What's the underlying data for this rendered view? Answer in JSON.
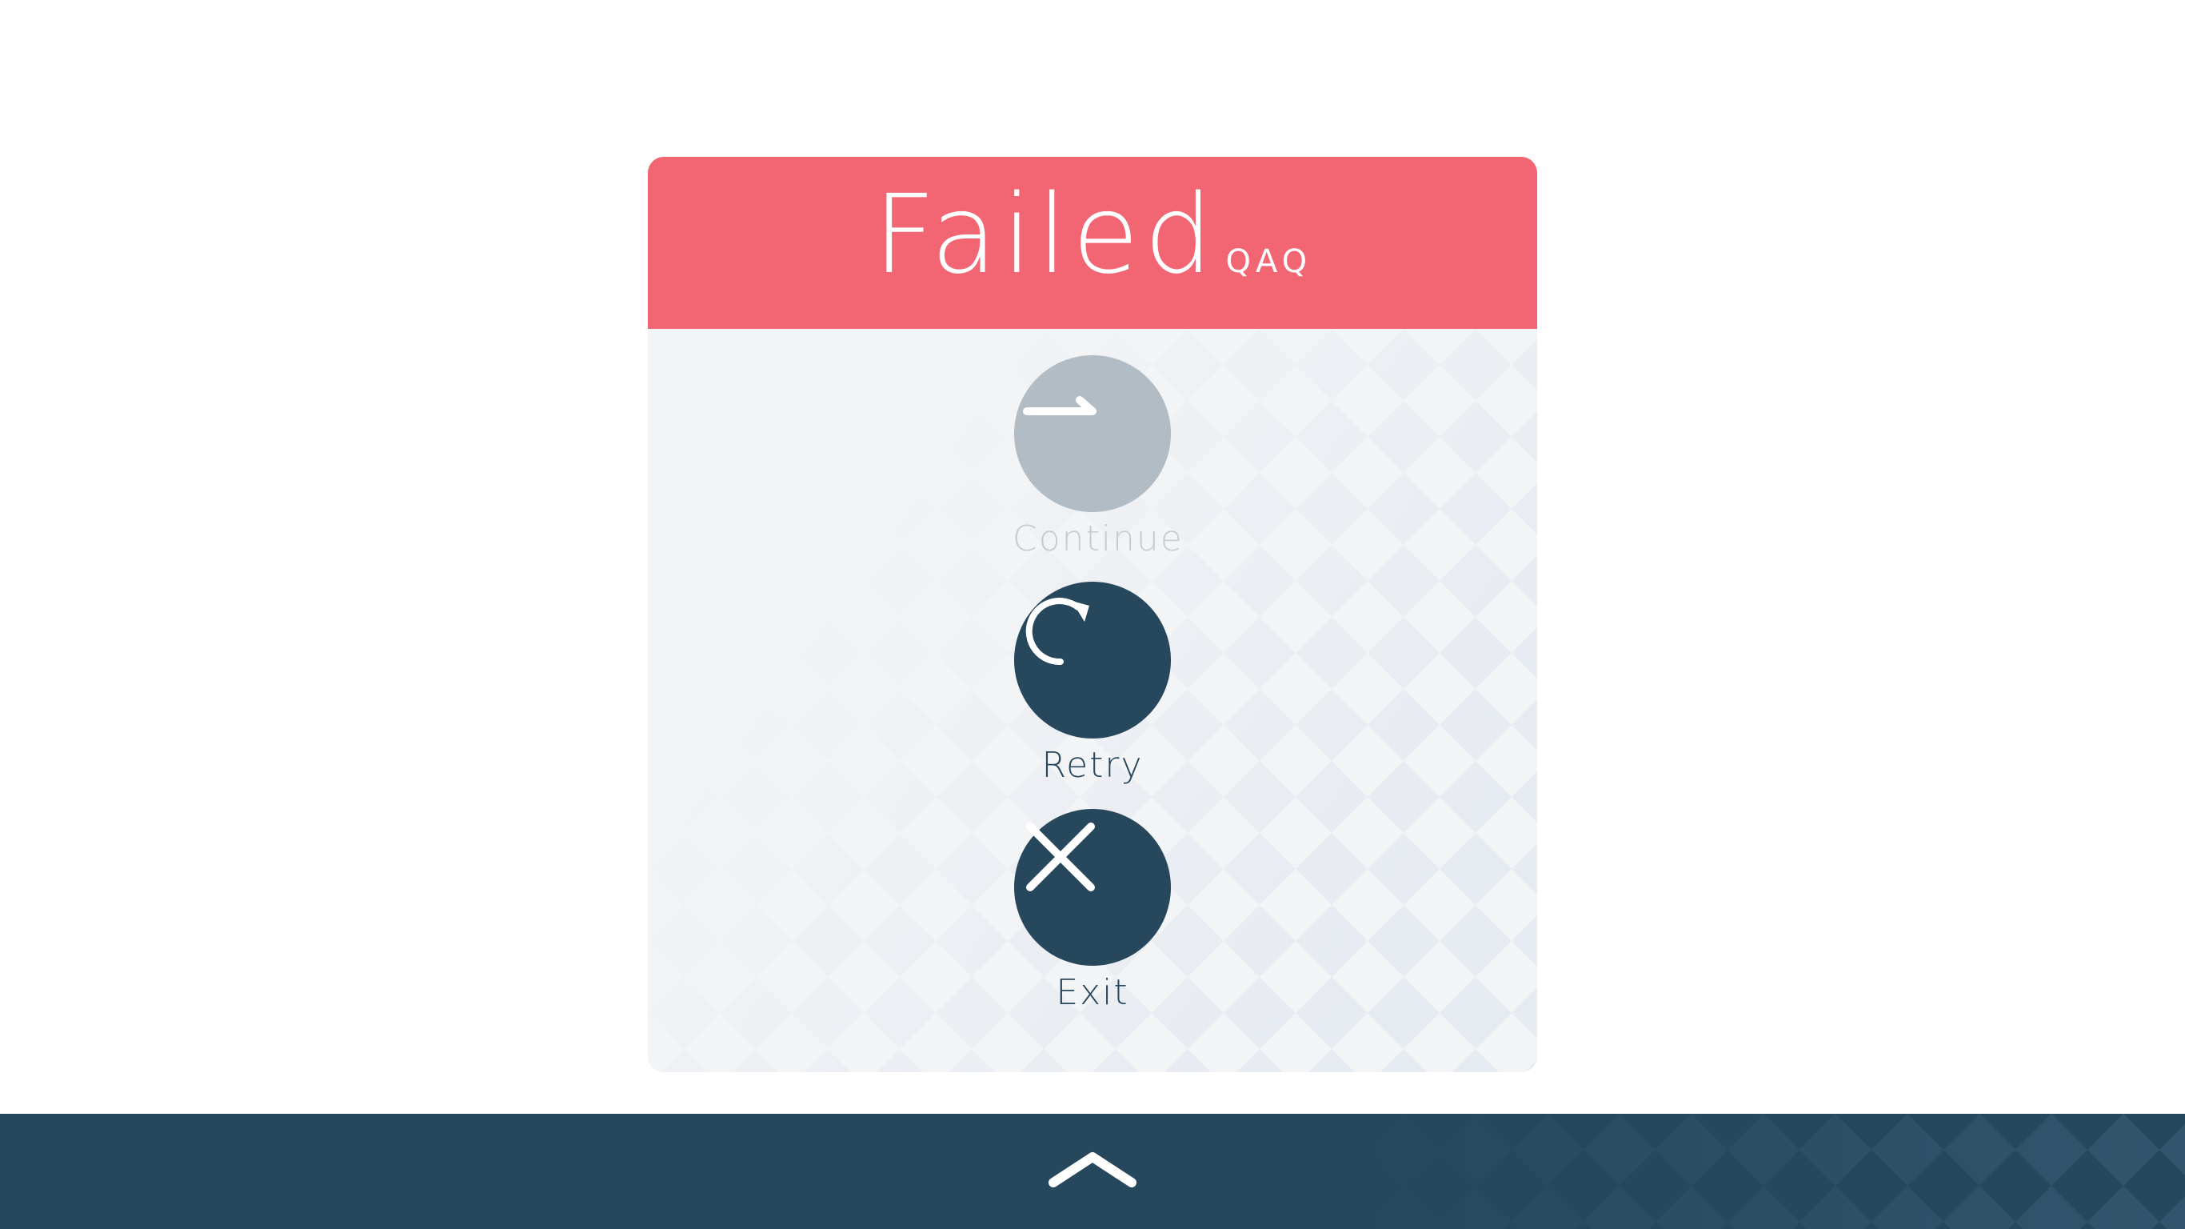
{
  "dialog": {
    "title": "Failed",
    "title_suffix": "QAQ",
    "header_color": "#f26674"
  },
  "actions": [
    {
      "label": "Continue",
      "icon": "continue-arrow-icon",
      "enabled": false
    },
    {
      "label": "Retry",
      "icon": "retry-icon",
      "enabled": true
    },
    {
      "label": "Exit",
      "icon": "close-icon",
      "enabled": true
    }
  ],
  "bottom_bar": {
    "icon": "chevron-up-icon",
    "color": "#27475d"
  }
}
